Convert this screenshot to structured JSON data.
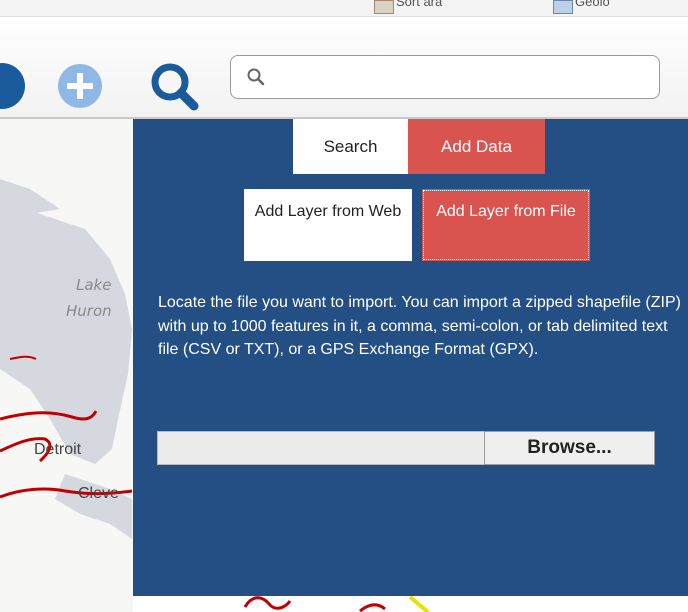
{
  "browser_strip": {
    "fragment_1": "Sort ara",
    "fragment_2": "Geolo"
  },
  "toolbar": {
    "search_placeholder": ""
  },
  "map": {
    "lake_label_line1": "Lake",
    "lake_label_line2": "Huron",
    "city_detroit": "Detroit",
    "city_cleveland_partial": "Cleve"
  },
  "panel": {
    "tabs": [
      {
        "label": "Search"
      },
      {
        "label": "Add Data"
      }
    ],
    "subtabs": [
      {
        "label": "Add Layer from Web"
      },
      {
        "label": "Add Layer from File"
      }
    ],
    "description": "Locate the file you want to import. You can import a zipped shapefile (ZIP) with up to 1000 features in it, a comma, semi-colon, or tab delimited text file (CSV or TXT), or a GPS Exchange Format (GPX).",
    "browse_label": "Browse..."
  },
  "colors": {
    "panel_bg": "#234f85",
    "active_red": "#d9534f",
    "toolbar_icon_blue": "#1b5b9c",
    "plus_icon": "#8fb8e6",
    "road_red": "#c00000"
  }
}
